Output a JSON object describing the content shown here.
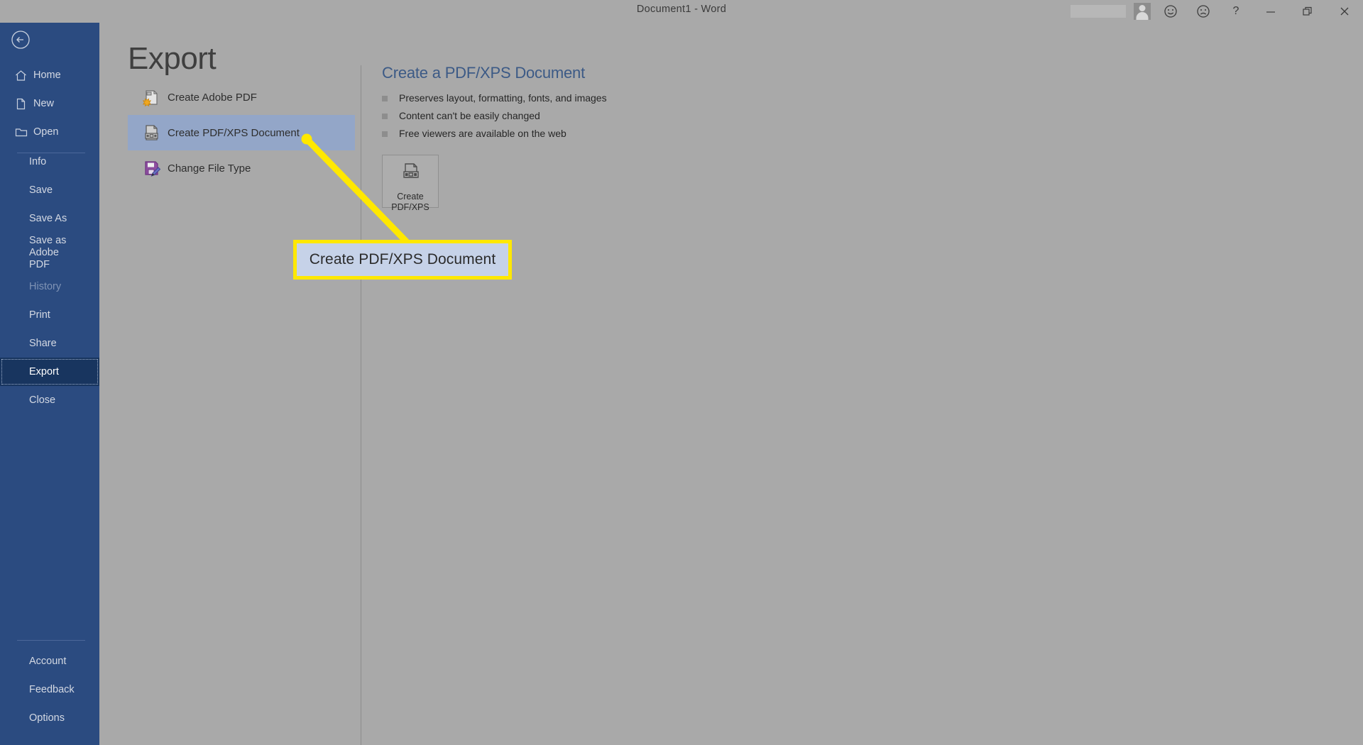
{
  "window": {
    "title": "Document1  -  Word",
    "controls": [
      {
        "name": "account-name-redacted",
        "label": ""
      },
      {
        "name": "user-avatar",
        "label": ""
      },
      {
        "name": "smiley-face-icon",
        "label": "☺"
      },
      {
        "name": "frowny-face-icon",
        "label": "☹"
      },
      {
        "name": "help-icon",
        "label": "?"
      },
      {
        "name": "minimize-button",
        "label": "—"
      },
      {
        "name": "restore-button",
        "label": "❐"
      },
      {
        "name": "close-button",
        "label": "✕"
      }
    ]
  },
  "sidebar": {
    "back_label": "Back",
    "top_items": [
      {
        "label": "Home",
        "icon": "home-icon"
      },
      {
        "label": "New",
        "icon": "new-document-icon"
      },
      {
        "label": "Open",
        "icon": "open-folder-icon"
      }
    ],
    "items": [
      {
        "label": "Info",
        "state": "normal"
      },
      {
        "label": "Save",
        "state": "normal"
      },
      {
        "label": "Save As",
        "state": "normal"
      },
      {
        "label": "Save as Adobe PDF",
        "state": "normal"
      },
      {
        "label": "History",
        "state": "disabled"
      },
      {
        "label": "Print",
        "state": "normal"
      },
      {
        "label": "Share",
        "state": "normal"
      },
      {
        "label": "Export",
        "state": "active"
      },
      {
        "label": "Close",
        "state": "normal"
      }
    ],
    "bottom_items": [
      {
        "label": "Account"
      },
      {
        "label": "Feedback"
      },
      {
        "label": "Options"
      }
    ]
  },
  "main": {
    "page_title": "Export",
    "options": [
      {
        "label": "Create Adobe PDF",
        "icon": "adobe-pdf-icon",
        "selected": false
      },
      {
        "label": "Create PDF/XPS Document",
        "icon": "pdf-xps-document-icon",
        "selected": true
      },
      {
        "label": "Change File Type",
        "icon": "change-file-type-icon",
        "selected": false
      }
    ],
    "detail": {
      "heading": "Create a PDF/XPS Document",
      "bullets": [
        "Preserves layout, formatting, fonts, and images",
        "Content can't be easily changed",
        "Free viewers are available on the web"
      ],
      "button": {
        "line1": "Create",
        "line2": "PDF/XPS",
        "icon": "pdf-xps-document-icon"
      }
    }
  },
  "annotation": {
    "callout_text": "Create PDF/XPS Document",
    "line_color": "#ffe800",
    "fill_color": "#c6d2e8"
  },
  "colors": {
    "sidebar_bg": "#2b4b80",
    "sidebar_active": "#18355f",
    "panel_bg": "#a9a9a9",
    "option_selected": "#93a6c8",
    "heading_blue": "#3c5a86",
    "highlight_yellow": "#ffe800"
  }
}
